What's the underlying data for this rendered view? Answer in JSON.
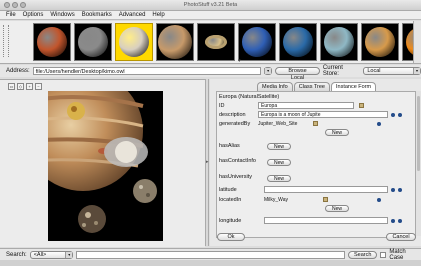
{
  "window": {
    "title": "PhotoStuff v3.21 Beta"
  },
  "menu": [
    "File",
    "Options",
    "Windows",
    "Bookmarks",
    "Advanced",
    "Help"
  ],
  "thumbnails": [
    {
      "name": "mars-thumbnail",
      "color": "#c2552c"
    },
    {
      "name": "moon-thumbnail",
      "color": "#8a8a8a"
    },
    {
      "name": "europa-thumbnail",
      "color": "#d8cfc0",
      "selected": true
    },
    {
      "name": "jupiter-thumbnail",
      "color": "#c79a6a"
    },
    {
      "name": "saturn-thumbnail",
      "color": "#d8c08a"
    },
    {
      "name": "neptune-thumbnail",
      "color": "#2f5fb5"
    },
    {
      "name": "earth-thumbnail",
      "color": "#2a6aa8"
    },
    {
      "name": "uranus-thumbnail",
      "color": "#8fb8c5"
    },
    {
      "name": "venus-thumbnail",
      "color": "#d79a4b"
    },
    {
      "name": "sun-thumbnail",
      "color": "#ee8a1a"
    }
  ],
  "address": {
    "label": "Address:",
    "value": "file:/Users/hendler/Desktop/kimo.owl",
    "browse_label": "Browse Local",
    "store_label": "Current Store:",
    "store_value": "Local"
  },
  "tabs": [
    "Media Info",
    "Class Tree",
    "Instance Form"
  ],
  "form": {
    "header": "Europa (NaturalSatellite)",
    "id_label": "ID",
    "id_value": "Europa",
    "description_label": "description",
    "description_value": "Europa is a moon of Jupite",
    "generatedby_label": "generatedBy",
    "generatedby_value": "Jupiter_Web_Site",
    "hasalias_label": "hasAlias",
    "hascontactinfo_label": "hasContactInfo",
    "hasuniversity_label": "hasUniversity",
    "latitude_label": "latitude",
    "locatedin_label": "locatedIn",
    "locatedin_value": "Milky_Way",
    "longitude_label": "longitude",
    "new_label": "New",
    "ok_label": "Ok",
    "cancel_label": "Cancel"
  },
  "search": {
    "label": "Search:",
    "scope_value": "<All>",
    "button_label": "Search",
    "match_case_label": "Match Case"
  },
  "colors": {
    "accent": "#244c8a",
    "selection": "#ffd900"
  }
}
